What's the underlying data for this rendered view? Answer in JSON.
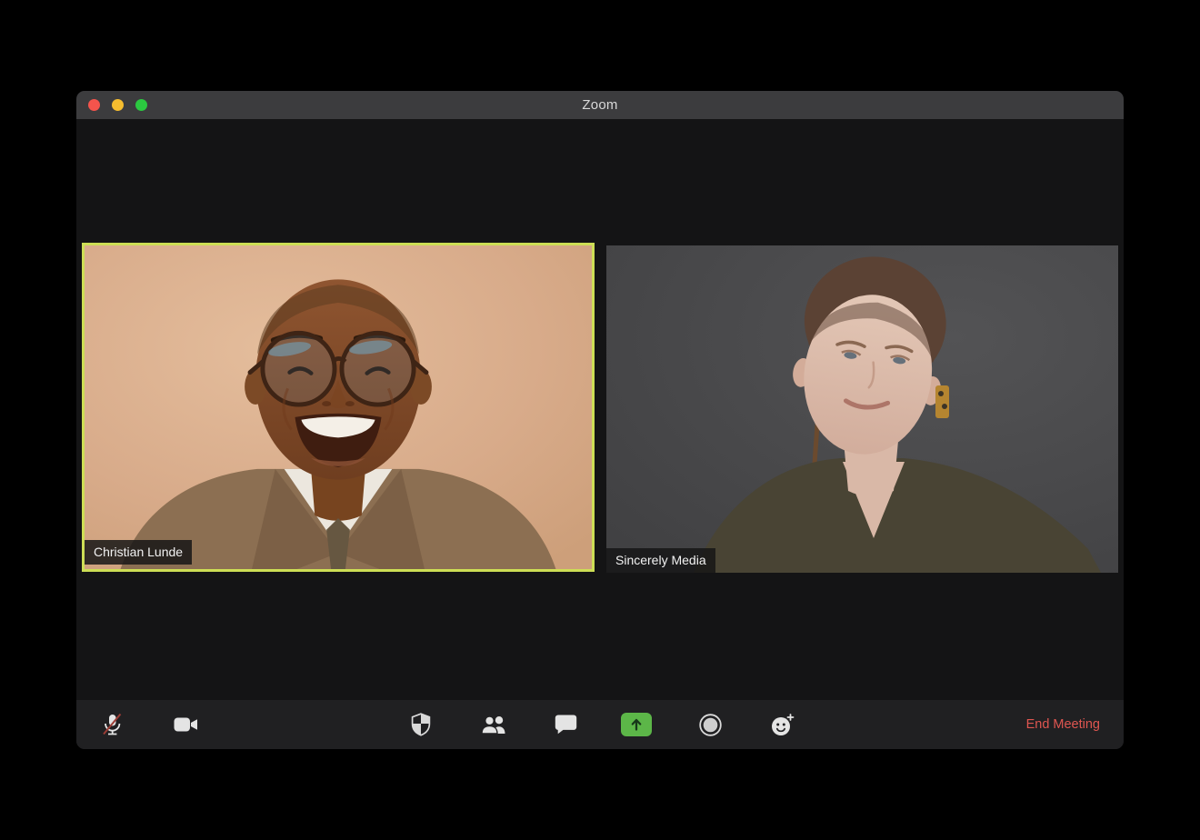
{
  "window": {
    "title": "Zoom"
  },
  "participants": [
    {
      "name": "Christian Lunde",
      "active_speaker": true
    },
    {
      "name": "Sincerely Media",
      "active_speaker": false
    }
  ],
  "toolbar": {
    "buttons": [
      {
        "id": "mute",
        "icon": "microphone-muted-icon",
        "state": "muted"
      },
      {
        "id": "video",
        "icon": "video-camera-icon"
      },
      {
        "id": "security",
        "icon": "shield-icon"
      },
      {
        "id": "participants",
        "icon": "participants-icon"
      },
      {
        "id": "chat",
        "icon": "chat-bubble-icon"
      },
      {
        "id": "share-screen",
        "icon": "share-screen-up-arrow-icon"
      },
      {
        "id": "record",
        "icon": "record-circle-icon"
      },
      {
        "id": "reactions",
        "icon": "smiley-plus-icon"
      }
    ],
    "end_meeting_label": "End Meeting"
  },
  "colors": {
    "active_speaker_border": "#cdde55",
    "share_button_green": "#5cb648",
    "end_meeting_red": "#df5650",
    "titlebar_bg": "#3c3c3e",
    "toolbar_bg": "#202022",
    "window_bg": "#151516",
    "traffic_red": "#f4544c",
    "traffic_yellow": "#f6bd2f",
    "traffic_green": "#2bc840"
  }
}
